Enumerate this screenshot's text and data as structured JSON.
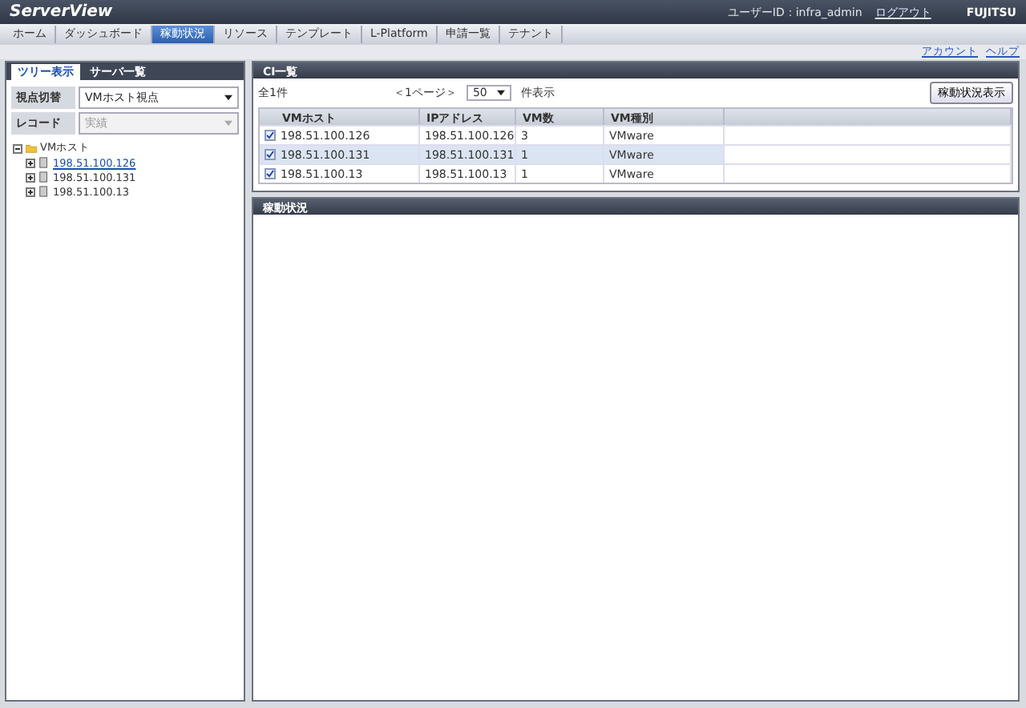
{
  "header": {
    "logo": "ServerView",
    "user_id": "ユーザーID：infra_admin",
    "logout": "ログアウト",
    "brand": "FUJITSU"
  },
  "nav_tabs": [
    {
      "label": "ホーム",
      "selected": false
    },
    {
      "label": "ダッシュボード",
      "selected": false
    },
    {
      "label": "稼動状況",
      "selected": true
    },
    {
      "label": "リソース",
      "selected": false
    },
    {
      "label": "テンプレート",
      "selected": false
    },
    {
      "label": "L-Platform",
      "selected": false
    },
    {
      "label": "申請一覧",
      "selected": false
    },
    {
      "label": "テナント",
      "selected": false
    }
  ],
  "sub_links": [
    "アカウント",
    "ヘルプ"
  ],
  "left_tabs": [
    {
      "label": "ツリー表示",
      "selected": true
    },
    {
      "label": "サーバ一覧",
      "selected": false
    }
  ],
  "filters": [
    {
      "label": "視点切替",
      "value": "VMホスト視点",
      "disabled": false
    },
    {
      "label": "レコード",
      "value": "実績",
      "disabled": true
    }
  ],
  "tree": [
    {
      "label": "VMホスト",
      "expanded": true,
      "children": [
        {
          "label": "198.51.100.126",
          "selected": true,
          "expanded": false
        },
        {
          "label": "198.51.100.131",
          "selected": false,
          "expanded": false
        },
        {
          "label": "198.51.100.13",
          "selected": false,
          "expanded": false
        }
      ]
    }
  ],
  "ci_panel": {
    "title": "CI一覧",
    "total": "全1件",
    "pager": "＜1ページ＞",
    "page_size": "50",
    "page_size_suffix": "件表示",
    "action_button": "稼動状況表示",
    "columns": [
      "VMホスト",
      "IPアドレス",
      "VM数",
      "VM種別"
    ],
    "rows": [
      {
        "checked": true,
        "selected": false,
        "cells": [
          "198.51.100.126",
          "198.51.100.126",
          "3",
          "VMware"
        ]
      },
      {
        "checked": true,
        "selected": true,
        "cells": [
          "198.51.100.131",
          "198.51.100.131",
          "1",
          "VMware"
        ]
      },
      {
        "checked": true,
        "selected": false,
        "cells": [
          "198.51.100.13",
          "198.51.100.13",
          "1",
          "VMware"
        ]
      }
    ]
  },
  "status_panel": {
    "title": "稼動状況"
  }
}
